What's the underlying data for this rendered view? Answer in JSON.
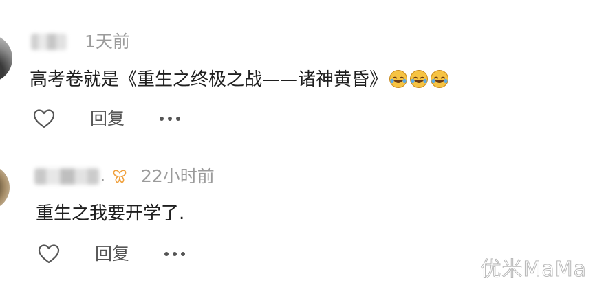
{
  "comments": [
    {
      "timestamp": "1天前",
      "text": "高考卷就是《重生之终极之战——诸神黄昏》",
      "emoji_count": 3,
      "emoji_icon": "rolling-on-floor-laughing-emoji",
      "actions": {
        "reply_label": "回复"
      }
    },
    {
      "name_suffix": ".",
      "badge_icon": "orange-butterfly-badge-icon",
      "badge_color": "#f0a03c",
      "timestamp": "22小时前",
      "text": "重生之我要开学了.",
      "actions": {
        "reply_label": "回复"
      }
    }
  ],
  "watermark": "优米MaMa",
  "colors": {
    "text": "#1f1f1f",
    "meta": "#9b9b9b",
    "action": "#555555",
    "emoji_face": "#f6c343"
  }
}
